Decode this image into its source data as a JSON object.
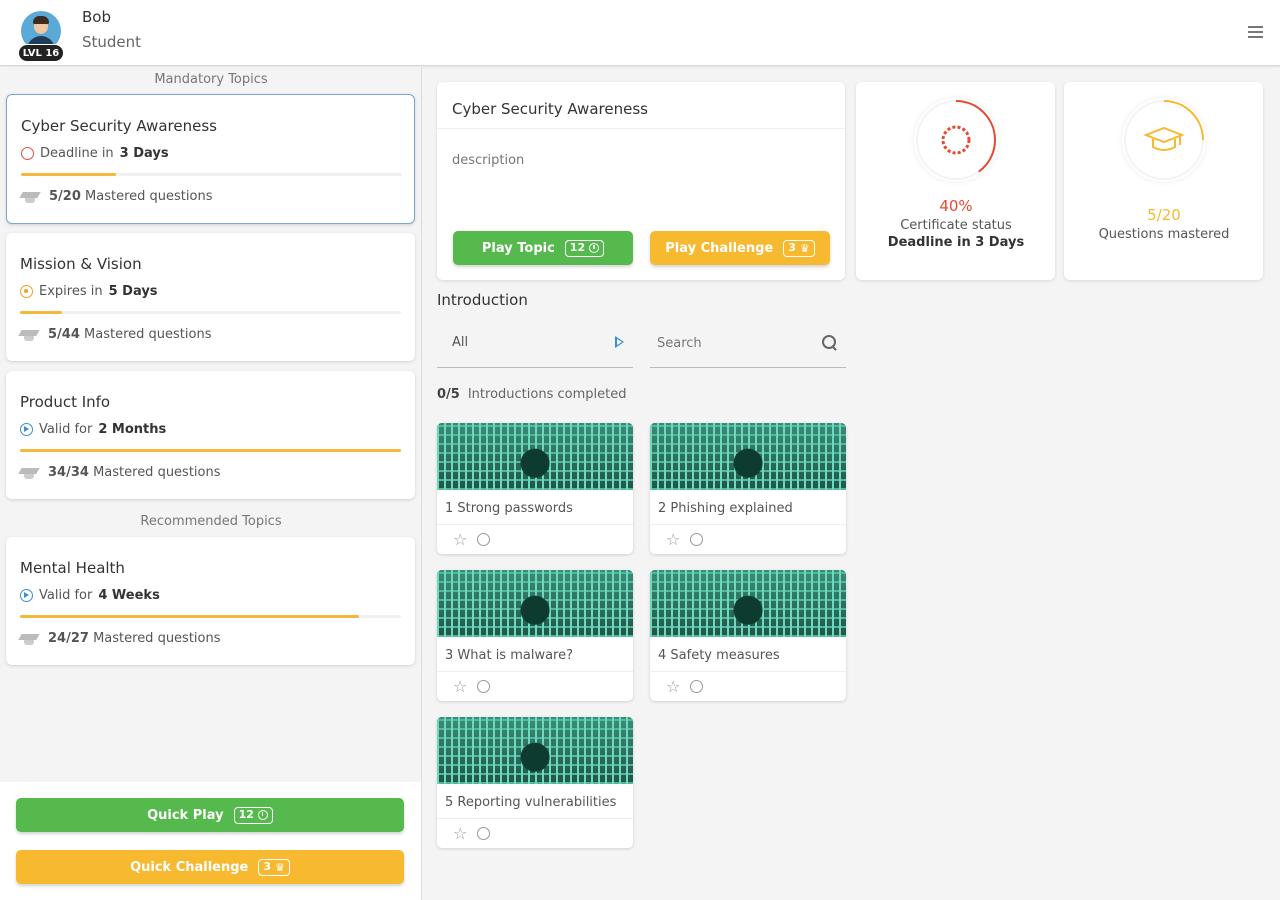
{
  "header": {
    "user_name": "Bob",
    "user_role": "Student",
    "level_badge": "LVL 16"
  },
  "sidebar": {
    "mandatory_label": "Mandatory Topics",
    "recommended_label": "Recommended Topics",
    "topics": [
      {
        "title": "Cyber Security Awareness",
        "status_prefix": "Deadline in",
        "status_value": "3 Days",
        "status_type": "deadline",
        "progress": 0.25,
        "mastered": "5/20",
        "mastered_label": "Mastered questions"
      },
      {
        "title": "Mission & Vision",
        "status_prefix": "Expires in",
        "status_value": "5 Days",
        "status_type": "expires",
        "progress": 0.11,
        "mastered": "5/44",
        "mastered_label": "Mastered questions"
      },
      {
        "title": "Product Info",
        "status_prefix": "Valid for",
        "status_value": "2 Months",
        "status_type": "valid",
        "progress": 1.0,
        "mastered": "34/34",
        "mastered_label": "Mastered questions"
      },
      {
        "title": "Mental Health",
        "status_prefix": "Valid for",
        "status_value": "4 Weeks",
        "status_type": "valid",
        "progress": 0.89,
        "mastered": "24/27",
        "mastered_label": "Mastered questions"
      }
    ],
    "quick_play": {
      "label": "Quick Play",
      "count": "12"
    },
    "quick_challenge": {
      "label": "Quick Challenge",
      "count": "3"
    }
  },
  "detail": {
    "title": "Cyber Security Awareness",
    "description": "description",
    "play_topic": {
      "label": "Play Topic",
      "count": "12"
    },
    "play_challenge": {
      "label": "Play Challenge",
      "count": "3"
    }
  },
  "stats": {
    "certificate": {
      "value": "40%",
      "label": "Certificate status",
      "sublabel": "Deadline in 3 Days",
      "progress": 0.4,
      "color": "#e64a2e"
    },
    "questions": {
      "value": "5/20",
      "label": "Questions mastered",
      "progress": 0.25,
      "color": "#f6b92f"
    }
  },
  "intro": {
    "heading": "Introduction",
    "filter_value": "All",
    "search_placeholder": "Search",
    "completed_count": "0/5",
    "completed_label": "Introductions completed",
    "items": [
      {
        "label": "1  Strong passwords"
      },
      {
        "label": "2  Phishing explained"
      },
      {
        "label": "3  What is malware?"
      },
      {
        "label": "4  Safety measures"
      },
      {
        "label": "5  Reporting vulnerabilities"
      }
    ]
  },
  "colors": {
    "green": "#55b94e",
    "yellow": "#f6b92f",
    "red": "#e64a2e",
    "blue": "#3a8fd0"
  },
  "icons": {
    "menu": "hamburger-menu-icon",
    "search": "search-icon",
    "star": "star-icon",
    "cap": "graduation-cap-icon",
    "clock": "clock-icon",
    "crown": "crown-icon"
  }
}
